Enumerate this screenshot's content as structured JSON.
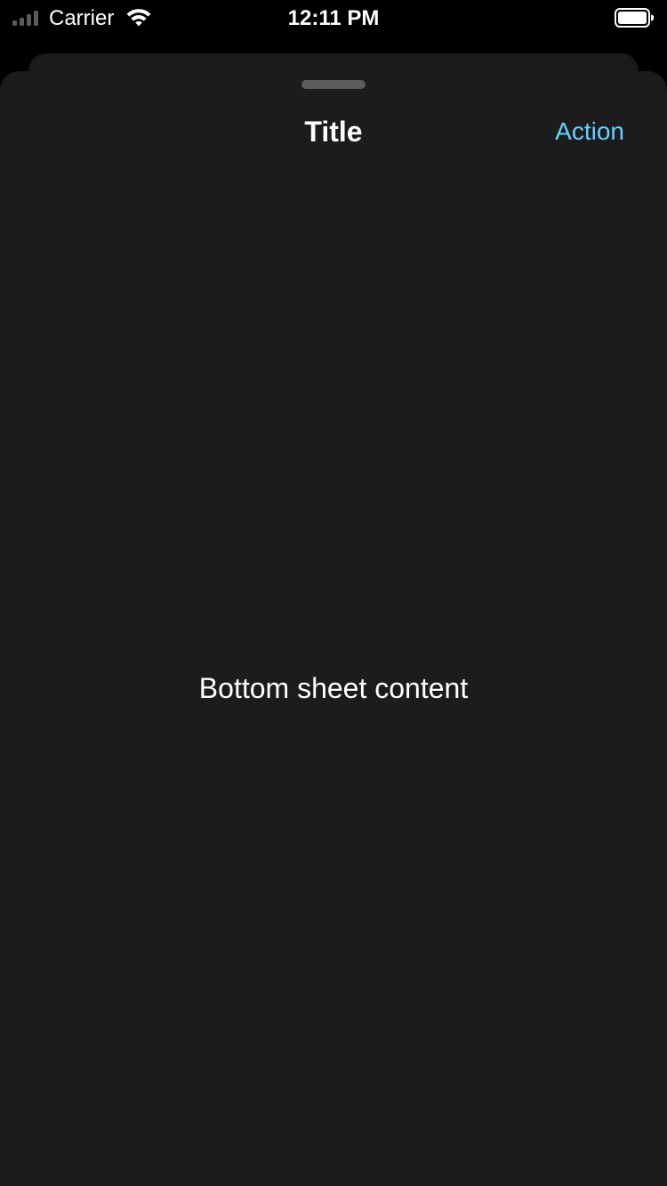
{
  "status_bar": {
    "carrier": "Carrier",
    "time": "12:11 PM",
    "signal_icon": "cellular-signal-icon",
    "wifi_icon": "wifi-icon",
    "battery_icon": "battery-icon",
    "battery_level": 1.0
  },
  "sheet": {
    "title": "Title",
    "action_label": "Action",
    "content_text": "Bottom sheet content"
  },
  "colors": {
    "background": "#000000",
    "sheet_background": "#1c1c1e",
    "accent": "#64d2ff",
    "text": "#ffffff"
  }
}
